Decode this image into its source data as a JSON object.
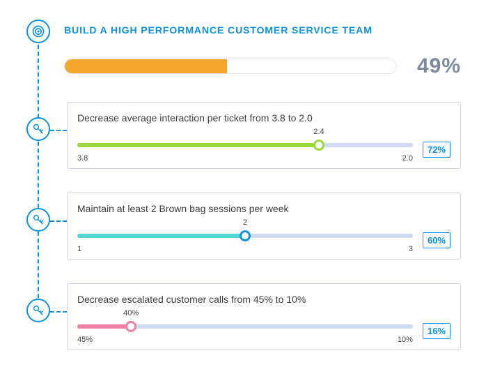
{
  "objective": {
    "title": "BUILD A HIGH PERFORMANCE CUSTOMER SERVICE TEAM",
    "overall_percent_label": "49%",
    "overall_percent": 49
  },
  "key_results": [
    {
      "title": "Decrease average interaction per ticket from 3.8 to 2.0",
      "start_label": "3.8",
      "end_label": "2.0",
      "current_label": "2.4",
      "progress_percent": 72,
      "badge": "72%",
      "color": "#9ad93a",
      "handle_border": "#9ad93a"
    },
    {
      "title": "Maintain at least 2 Brown bag sessions per week",
      "start_label": "1",
      "end_label": "3",
      "current_label": "2",
      "progress_percent": 50,
      "badge": "60%",
      "color": "#4fd8d6",
      "handle_border": "#0d93e2"
    },
    {
      "title": "Decrease escalated customer calls from 45% to 10%",
      "start_label": "45%",
      "end_label": "10%",
      "current_label": "40%",
      "progress_percent": 16,
      "badge": "16%",
      "color": "#f07fa7",
      "handle_border": "#f07fa7"
    }
  ],
  "icons": {
    "objective": "target-icon",
    "key_result": "key-icon"
  },
  "colors": {
    "brand": "#0d93e2",
    "overall_fill": "#f3a72a",
    "muted_text": "#7c8aa0",
    "track": "#cfd9ef",
    "card_border": "#cfd6e2"
  }
}
